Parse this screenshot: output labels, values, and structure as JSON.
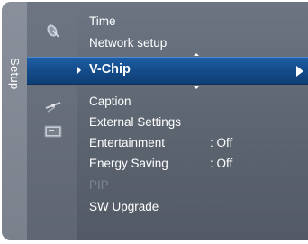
{
  "side_tab": {
    "label": "Setup"
  },
  "menu": {
    "items": [
      {
        "label": "Time",
        "value": ""
      },
      {
        "label": "Network setup",
        "value": ""
      },
      {
        "label": "V-Chip",
        "value": "",
        "selected": true
      },
      {
        "label": "Caption",
        "value": ""
      },
      {
        "label": "External Settings",
        "value": ""
      },
      {
        "label": "Entertainment",
        "value": ": Off"
      },
      {
        "label": "Energy Saving",
        "value": ": Off"
      },
      {
        "label": "PIP",
        "value": "",
        "disabled": true
      },
      {
        "label": "SW Upgrade",
        "value": ""
      }
    ]
  },
  "icons": [
    "satellite-dish-icon",
    "gear-icon",
    "antenna-icon",
    "input-icon"
  ],
  "colors": {
    "panel": "#5f6672",
    "selected": "#134a88",
    "disabled_text": "#7d8491"
  }
}
